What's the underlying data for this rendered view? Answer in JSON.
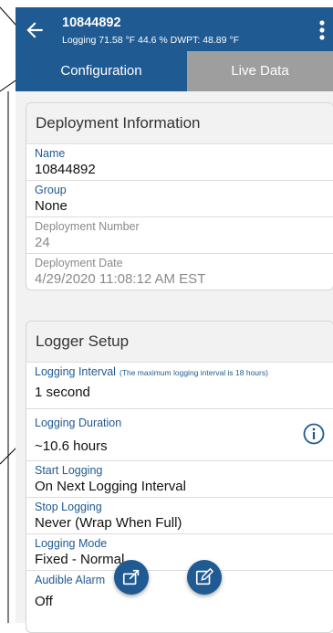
{
  "header": {
    "title": "10844892",
    "subtitle": "Logging 71.58 °F 44.6 % DWPT: 48.89 °F"
  },
  "tabs": [
    {
      "label": "Configuration",
      "active": true
    },
    {
      "label": "Live Data",
      "active": false
    }
  ],
  "deployment": {
    "title": "Deployment Information",
    "fields": [
      {
        "label": "Name",
        "value": "10844892"
      },
      {
        "label": "Group",
        "value": "None"
      },
      {
        "label": "Deployment Number",
        "value": "24"
      },
      {
        "label": "Deployment Date",
        "value": "4/29/2020 11:08:12 AM EST"
      }
    ]
  },
  "logger_setup": {
    "title": "Logger Setup",
    "logging_interval": {
      "label": "Logging Interval",
      "note": "(The maximum logging interval is 18 hours)",
      "value": "1 second"
    },
    "logging_duration": {
      "label": "Logging Duration",
      "value": "~10.6 hours"
    },
    "start_logging": {
      "label": "Start Logging",
      "value": "On Next Logging Interval"
    },
    "stop_logging": {
      "label": "Stop Logging",
      "value": "Never (Wrap When Full)"
    },
    "logging_mode": {
      "label": "Logging Mode",
      "value": "Fixed - Normal"
    },
    "audible_alarm": {
      "label": "Audible Alarm",
      "value": "Off"
    }
  },
  "icons": {
    "back": "arrow-left-icon",
    "menu": "vertical-dots-icon",
    "info": "info-circle-icon",
    "export": "export-icon",
    "edit": "edit-icon"
  },
  "colors": {
    "primary": "#1f5a92",
    "tab_inactive": "#9e9e9e"
  }
}
